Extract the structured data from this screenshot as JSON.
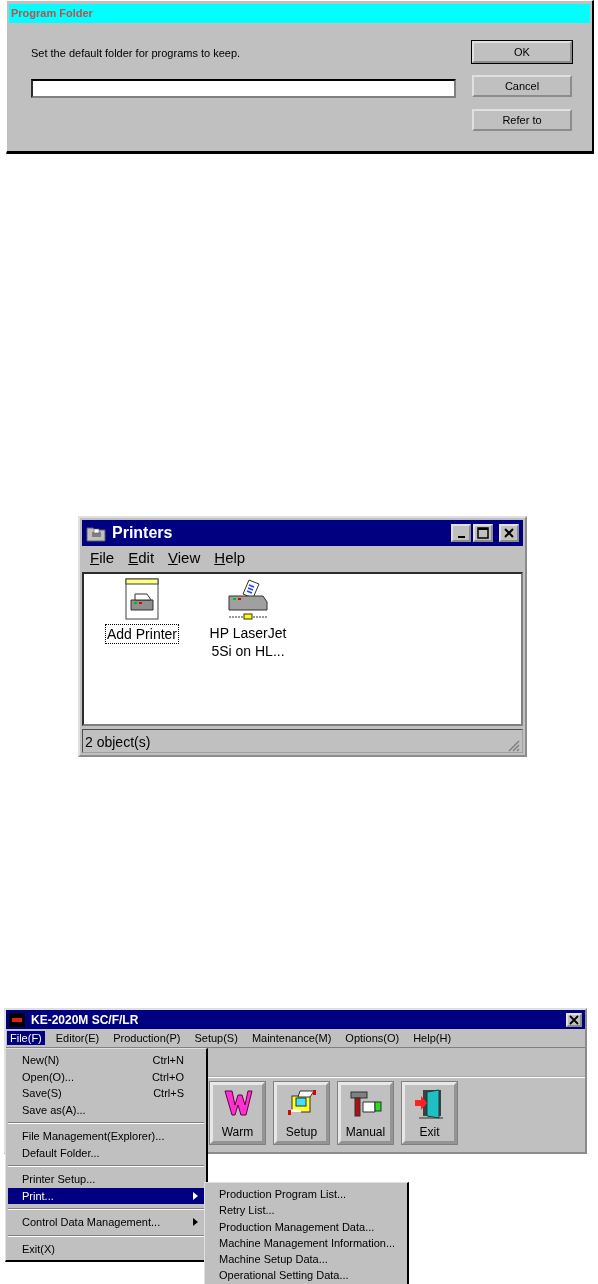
{
  "program_folder_dialog": {
    "title": "Program Folder",
    "prompt": "Set the default folder for programs to keep.",
    "buttons": [
      {
        "label": "OK",
        "default": true
      },
      {
        "label": "Cancel",
        "default": false
      },
      {
        "label": "Refer to",
        "default": false
      }
    ]
  },
  "printers_window": {
    "title": "Printers",
    "menu": [
      "File",
      "Edit",
      "View",
      "Help"
    ],
    "items": [
      {
        "label": "Add Printer",
        "kind": "add",
        "selected": true
      },
      {
        "label": "HP LaserJet 5Si on HL...",
        "kind": "network",
        "selected": false
      }
    ],
    "status_bar": "2 object(s)"
  },
  "app_window": {
    "title": "KE-2020M SC/F/LR",
    "menu": [
      {
        "label": "File(F)",
        "selected": true
      },
      {
        "label": "Editor(E)",
        "selected": false
      },
      {
        "label": "Production(P)",
        "selected": false
      },
      {
        "label": "Setup(S)",
        "selected": false
      },
      {
        "label": "Maintenance(M)",
        "selected": false
      },
      {
        "label": "Options(O)",
        "selected": false
      },
      {
        "label": "Help(H)",
        "selected": false
      }
    ],
    "toolbar_buttons": [
      {
        "label": "Warm",
        "kind": "warm"
      },
      {
        "label": "Setup",
        "kind": "setup"
      },
      {
        "label": "Manual",
        "kind": "manual"
      },
      {
        "label": "Exit",
        "kind": "exit"
      }
    ],
    "file_menu": [
      {
        "kind": "item",
        "label": "New(N)",
        "shortcut": "Ctrl+N",
        "selected": false,
        "has_submenu": false
      },
      {
        "kind": "item",
        "label": "Open(O)...",
        "shortcut": "Ctrl+O",
        "selected": false,
        "has_submenu": false
      },
      {
        "kind": "item",
        "label": "Save(S)",
        "shortcut": "Ctrl+S",
        "selected": false,
        "has_submenu": false
      },
      {
        "kind": "item",
        "label": "Save as(A)...",
        "selected": false,
        "has_submenu": false
      },
      {
        "kind": "separator"
      },
      {
        "kind": "item",
        "label": "File Management(Explorer)...",
        "selected": false,
        "has_submenu": false
      },
      {
        "kind": "item",
        "label": "Default Folder...",
        "selected": false,
        "has_submenu": false
      },
      {
        "kind": "separator"
      },
      {
        "kind": "item",
        "label": "Printer Setup...",
        "selected": false,
        "has_submenu": false
      },
      {
        "kind": "item",
        "label": "Print...",
        "selected": true,
        "has_submenu": true
      },
      {
        "kind": "separator"
      },
      {
        "kind": "item",
        "label": "Control Data Management...",
        "selected": false,
        "has_submenu": true
      },
      {
        "kind": "separator"
      },
      {
        "kind": "item",
        "label": "Exit(X)",
        "selected": false,
        "has_submenu": false
      }
    ],
    "print_submenu": [
      "Production Program List...",
      "Retry List...",
      "Production Management Data...",
      "Machine Management Information...",
      "Machine Setup Data...",
      "Operational Setting Data..."
    ]
  }
}
